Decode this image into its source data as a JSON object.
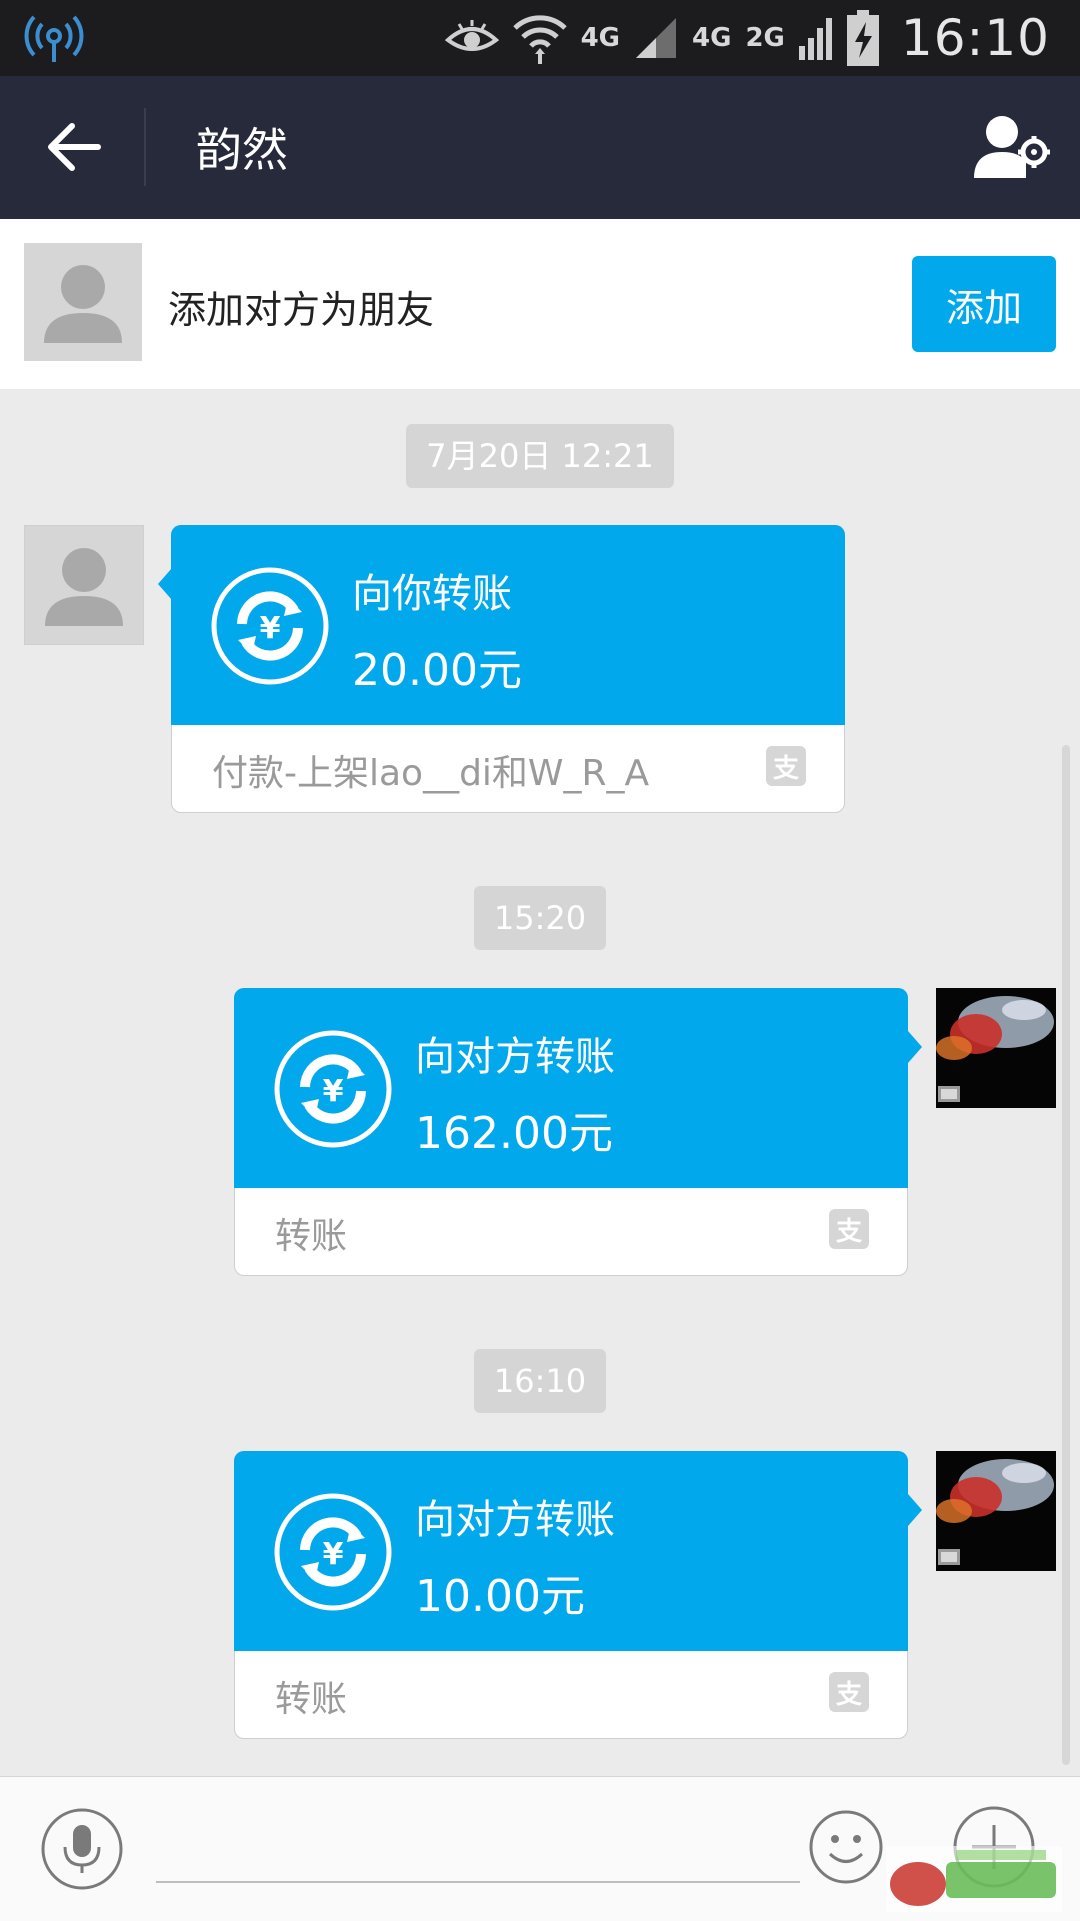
{
  "status_bar": {
    "network_1": "4G",
    "network_2": "4G",
    "network_3": "2G",
    "time": "16:10",
    "icons": [
      "signal-tower-icon",
      "eye-icon",
      "wifi-icon",
      "signal-bars-icon",
      "battery-charging-icon"
    ]
  },
  "header": {
    "title": "韵然",
    "back_icon": "back-arrow-icon",
    "settings_icon": "contact-settings-icon"
  },
  "add_friend": {
    "text": "添加对方为朋友",
    "button_label": "添加"
  },
  "messages": [
    {
      "timestamp": "7月20日 12:21",
      "direction": "incoming",
      "title": "向你转账",
      "amount": "20.00元",
      "note": "付款-上架lao__di和W_R_A"
    },
    {
      "timestamp": "15:20",
      "direction": "outgoing",
      "title": "向对方转账",
      "amount": "162.00元",
      "note": "转账"
    },
    {
      "timestamp": "16:10",
      "direction": "outgoing",
      "title": "向对方转账",
      "amount": "10.00元",
      "note": "转账"
    }
  ],
  "input_bar": {
    "voice_icon": "microphone-icon",
    "emoji_icon": "smiley-icon",
    "plus_icon": "plus-icon",
    "placeholder": ""
  },
  "colors": {
    "accent": "#02a8ec",
    "header_bg": "#272a3b",
    "chat_bg": "#ebebeb",
    "status_bar_bg": "#1c1c1f"
  }
}
